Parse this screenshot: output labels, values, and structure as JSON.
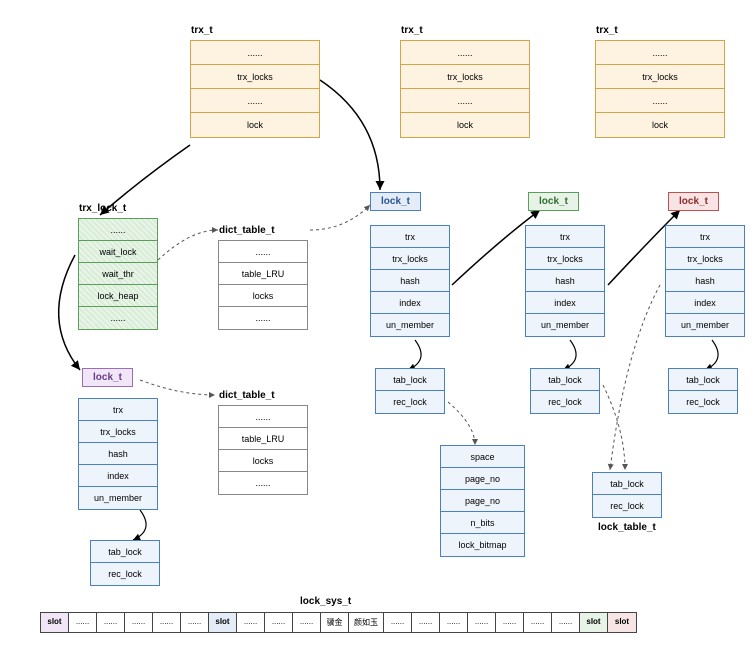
{
  "trx_boxes": {
    "title": "trx_t",
    "cells": [
      "......",
      "trx_locks",
      "......",
      "lock"
    ]
  },
  "trx_lock_t": {
    "title": "trx_lock_t",
    "cells": [
      "......",
      "wait_lock",
      "wait_thr",
      "lock_heap",
      "......"
    ]
  },
  "lock_t_label": "lock_t",
  "lock_t_fields": {
    "cells": [
      "trx",
      "trx_locks",
      "hash",
      "index",
      "un_member"
    ]
  },
  "lock_sub": {
    "cells": [
      "tab_lock",
      "rec_lock"
    ]
  },
  "dict_table_t": {
    "title": "dict_table_t",
    "cells": [
      "......",
      "table_LRU",
      "locks",
      "......"
    ]
  },
  "rec_detail": {
    "cells": [
      "space",
      "page_no",
      "page_no",
      "n_bits",
      "lock_bitmap"
    ]
  },
  "lock_table_t_label": "lock_table_t",
  "lock_sys_t_label": "lock_sys_t",
  "slots": {
    "slot_label": "slot",
    "dots": "......",
    "cjk1": "骥金",
    "cjk2": "颜如玉"
  }
}
